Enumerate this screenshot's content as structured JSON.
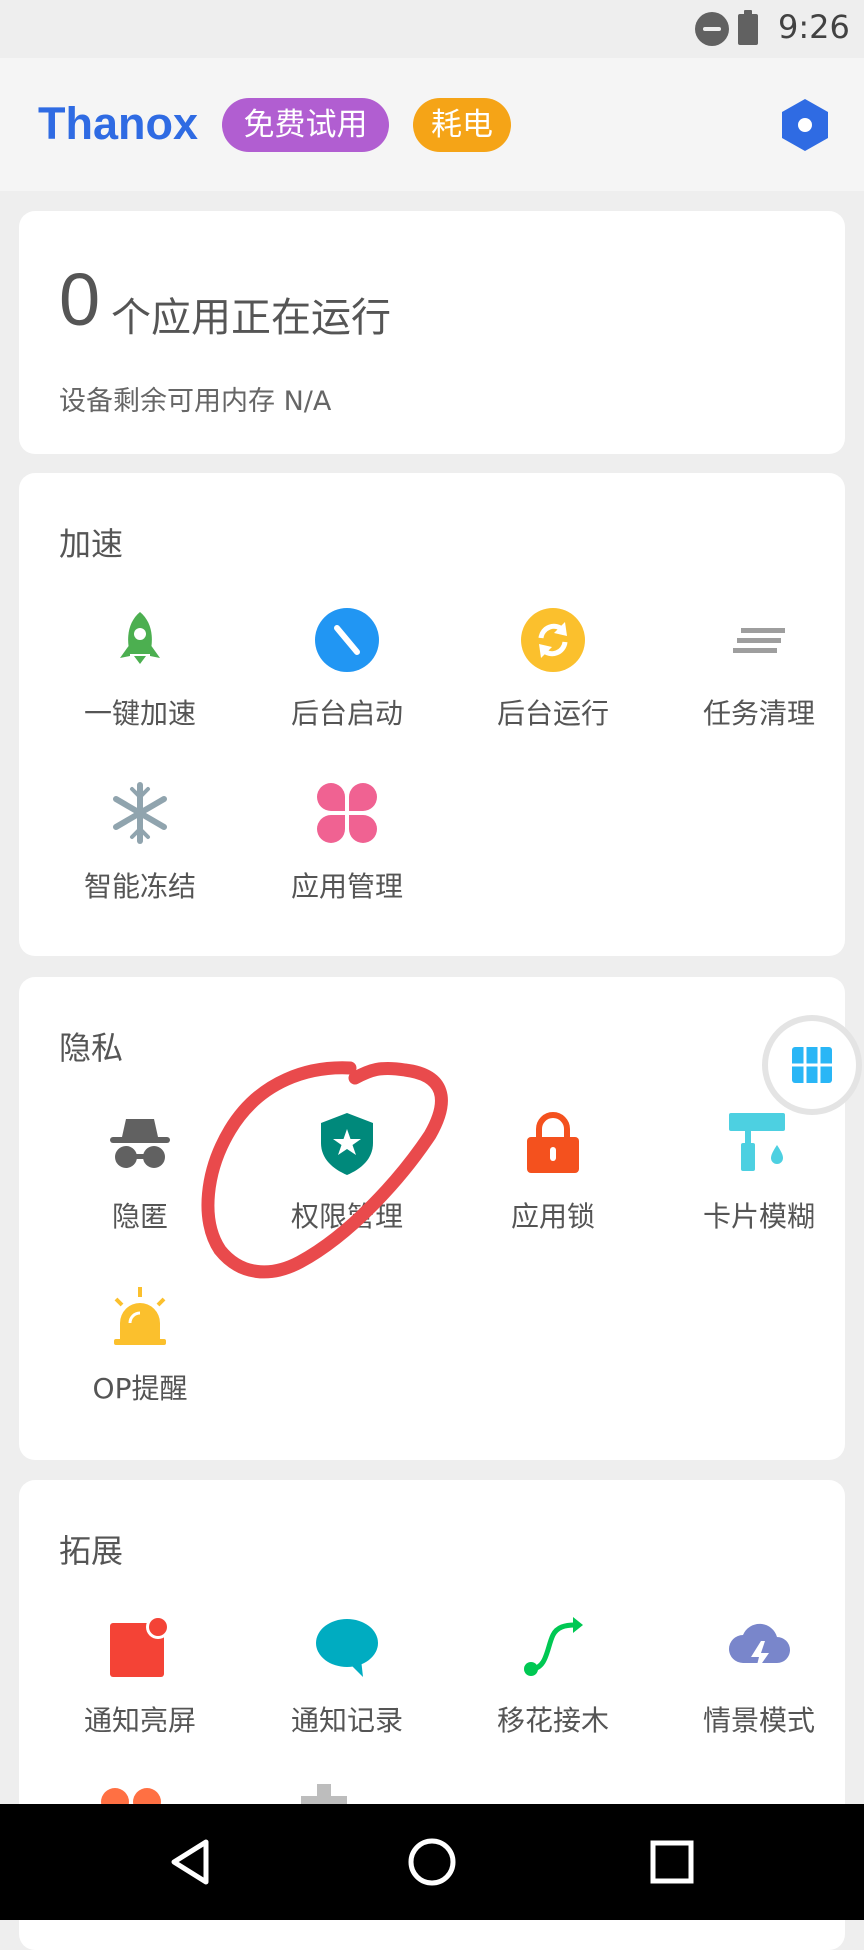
{
  "status_bar": {
    "time": "9:26"
  },
  "header": {
    "title": "Thanox",
    "badge_trial": "免费试用",
    "badge_power": "耗电"
  },
  "status_card": {
    "running_count": "0",
    "running_label": "个应用正在运行",
    "memory_label": "设备剩余可用内存 N/A"
  },
  "speed": {
    "title": "加速",
    "items": [
      {
        "label": "一键加速",
        "icon": "rocket-icon",
        "color": "#4caf50"
      },
      {
        "label": "后台启动",
        "icon": "background-start-icon",
        "color": "#2196f3"
      },
      {
        "label": "后台运行",
        "icon": "background-run-icon",
        "color": "#fbc02d"
      },
      {
        "label": "任务清理",
        "icon": "task-clean-icon",
        "color": "#9e9e9e"
      },
      {
        "label": "智能冻结",
        "icon": "snowflake-icon",
        "color": "#90a4ae"
      },
      {
        "label": "应用管理",
        "icon": "app-manage-icon",
        "color": "#f06292"
      }
    ]
  },
  "privacy": {
    "title": "隐私",
    "items": [
      {
        "label": "隐匿",
        "icon": "incognito-icon",
        "color": "#616161"
      },
      {
        "label": "权限管理",
        "icon": "shield-star-icon",
        "color": "#00897b"
      },
      {
        "label": "应用锁",
        "icon": "lock-icon",
        "color": "#f4511e"
      },
      {
        "label": "卡片模糊",
        "icon": "paint-roller-icon",
        "color": "#4dd0e1"
      },
      {
        "label": "OP提醒",
        "icon": "alarm-light-icon",
        "color": "#fbc02d"
      }
    ]
  },
  "extend": {
    "title": "拓展",
    "items": [
      {
        "label": "通知亮屏",
        "icon": "notification-icon",
        "color": "#f44336"
      },
      {
        "label": "通知记录",
        "icon": "chat-bubble-icon",
        "color": "#00acc1"
      },
      {
        "label": "移花接木",
        "icon": "route-icon",
        "color": "#00c853"
      },
      {
        "label": "情景模式",
        "icon": "cloud-bolt-icon",
        "color": "#7986cb"
      }
    ]
  }
}
